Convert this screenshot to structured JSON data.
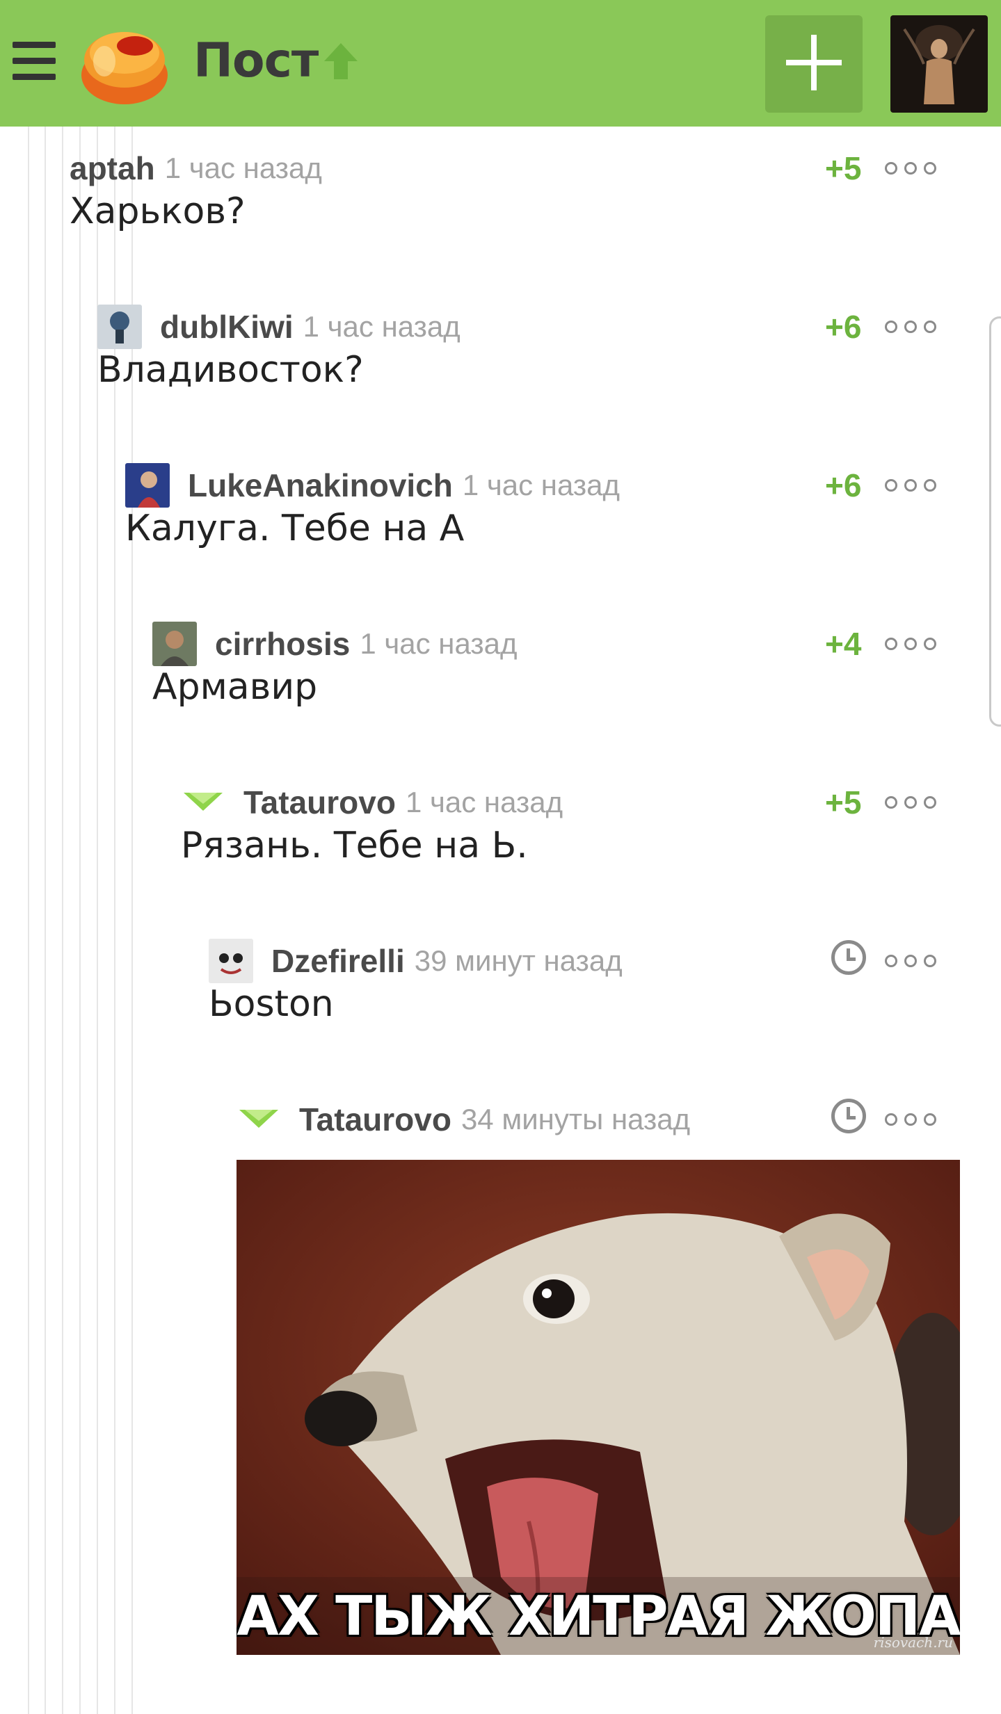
{
  "header": {
    "title": "Пост",
    "menu_icon": "hamburger-icon",
    "up_icon": "arrow-up-icon",
    "add_icon": "plus-icon",
    "brand_color": "#8ac858",
    "accent_color": "#6cb33e"
  },
  "comments": [
    {
      "username": "aptah",
      "time": "1 час назад",
      "text": "Харьков?",
      "rating": "+5"
    },
    {
      "username": "dublKiwi",
      "time": "1 час назад",
      "text": "Владивосток?",
      "rating": "+6"
    },
    {
      "username": "LukeAnakinovich",
      "time": "1 час назад",
      "text": "Калуга. Тебе на А",
      "rating": "+6"
    },
    {
      "username": "cirrhosis",
      "time": "1 час назад",
      "text": "Армавир",
      "rating": "+4"
    },
    {
      "username": "Tataurovo",
      "time": "1 час назад",
      "text": "Рязань. Тебе на Ь.",
      "rating": "+5"
    },
    {
      "username": "Dzefirelli",
      "time": "39 минут назад",
      "text": "Ьoston",
      "rating": ""
    },
    {
      "username": "Tataurovo",
      "time": "34 минуты назад",
      "text": "",
      "rating": ""
    }
  ],
  "meme": {
    "caption": "АХ ТЫЖ ХИТРАЯ ЖОПА",
    "watermark": "risovach.ru"
  }
}
